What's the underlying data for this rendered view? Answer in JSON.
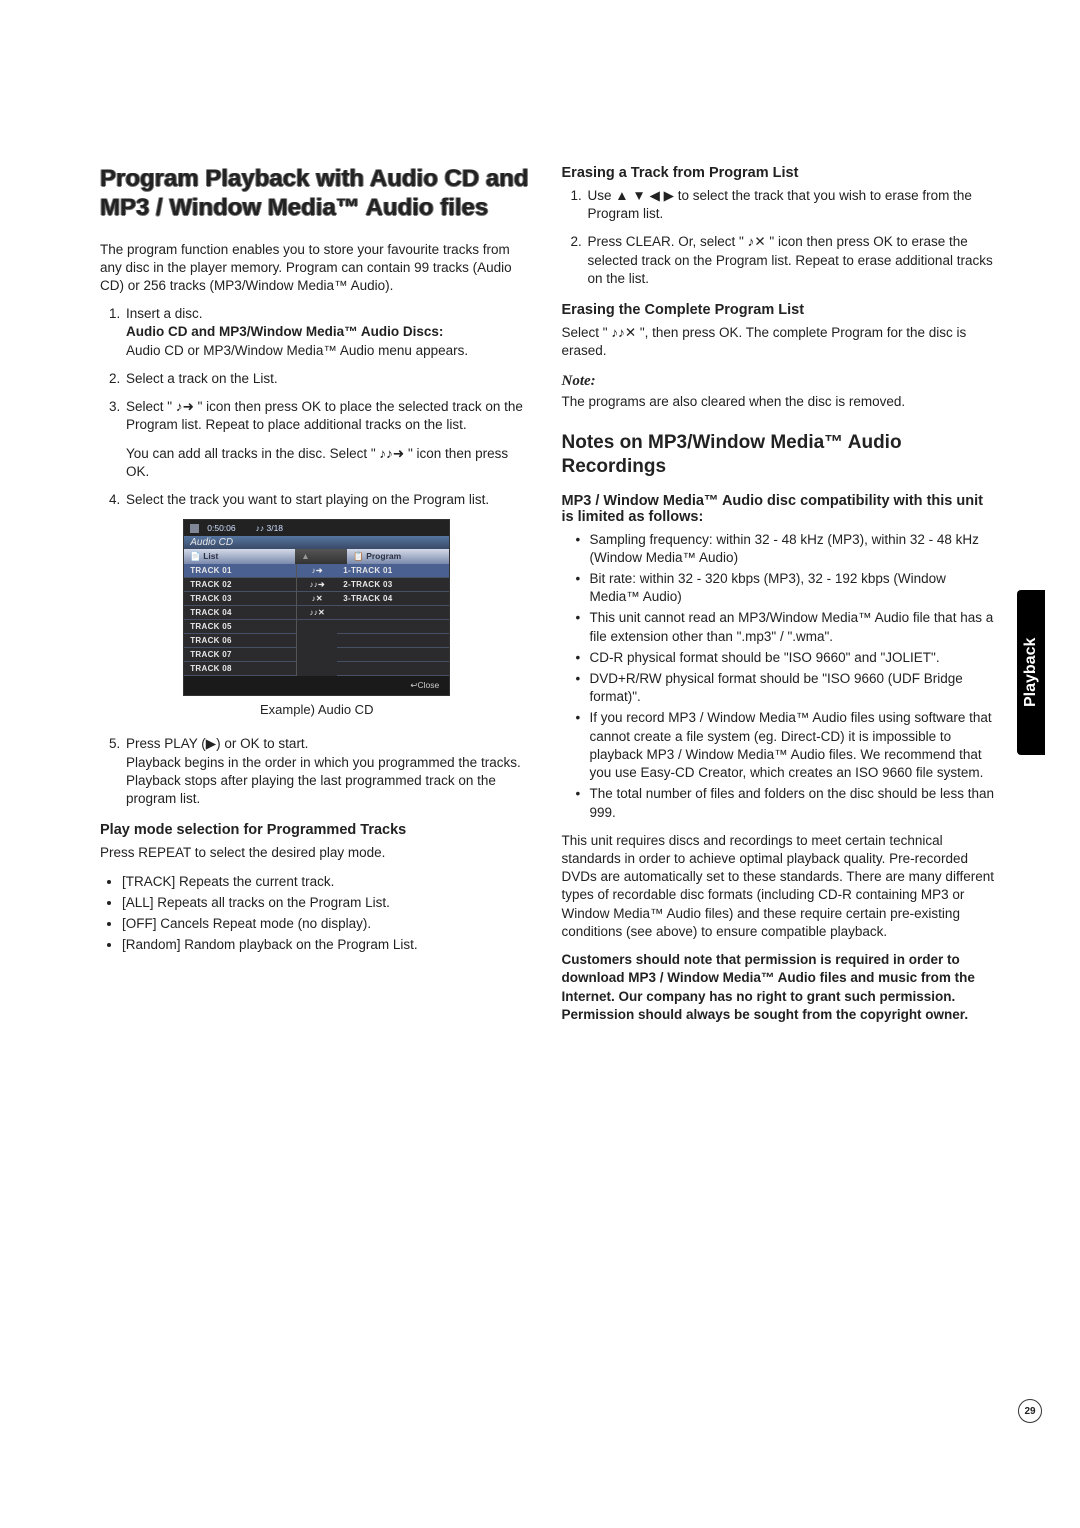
{
  "sidebar_tab": "Playback",
  "page_number": "29",
  "left": {
    "h1": "Program Playback with Audio CD and MP3 / Window Media™ Audio files",
    "intro": "The program function enables you to store your favourite tracks from any disc in the player memory. Program can contain 99 tracks (Audio CD) or 256 tracks (MP3/Window Media™ Audio).",
    "step1a": "Insert a disc.",
    "step1b": "Audio CD and MP3/Window Media™ Audio Discs:",
    "step1c": "Audio CD or MP3/Window Media™ Audio menu appears.",
    "step2": "Select a track on the List.",
    "step3a": "Select \" ♪➜ \" icon then press OK to place the selected track on the Program list. Repeat to place additional tracks on the list.",
    "step3b": "You can add all tracks in the disc. Select \" ♪♪➜ \" icon then press OK.",
    "step4": "Select the track you want to start playing on the Program list.",
    "shot": {
      "time": "0:50:06",
      "counter": "♪♪ 3/18",
      "subtitle": "Audio CD",
      "list_header": "List",
      "prog_header": "Program",
      "tracks": [
        "TRACK 01",
        "TRACK 02",
        "TRACK 03",
        "TRACK 04",
        "TRACK 05",
        "TRACK 06",
        "TRACK 07",
        "TRACK 08"
      ],
      "mids": [
        "♪➜",
        "♪♪➜",
        "♪✕",
        "♪♪✕"
      ],
      "prog": [
        "1-TRACK 01",
        "2-TRACK 03",
        "3-TRACK 04"
      ],
      "close": "↩Close"
    },
    "caption": "Example) Audio CD",
    "step5a": "Press PLAY (▶) or OK to start.",
    "step5b": "Playback begins in the order in which you programmed the tracks.",
    "step5c": "Playback stops after playing the last programmed track on the program list.",
    "h3_playmode": "Play mode selection for Programmed Tracks",
    "playmode_intro": "Press REPEAT to select the desired play mode.",
    "playmodes": [
      "[TRACK] Repeats the current track.",
      "[ALL] Repeats all tracks on the Program List.",
      "[OFF] Cancels Repeat mode (no display).",
      "[Random] Random playback on the Program List."
    ]
  },
  "right": {
    "h3_erase_track": "Erasing a Track from Program List",
    "erase_step1": "Use ▲ ▼ ◀ ▶ to select the track that you wish to erase from the Program list.",
    "erase_step2": "Press CLEAR. Or, select \" ♪✕ \" icon then press OK to erase the selected track on the Program list. Repeat to erase additional tracks on the list.",
    "h3_erase_all": "Erasing the Complete Program List",
    "erase_all_p": "Select \" ♪♪✕ \", then press OK. The complete Program for the disc is erased.",
    "note_label": "Note:",
    "note_p": "The programs are also cleared when the disc is removed.",
    "h2_notes": "Notes on MP3/Window Media™ Audio Recordings",
    "h3_compat": "MP3 / Window Media™ Audio disc compatibility with this unit is limited as follows:",
    "bullets": [
      "Sampling frequency: within 32 - 48 kHz (MP3), within 32 - 48 kHz (Window Media™ Audio)",
      "Bit rate: within 32 - 320 kbps (MP3), 32 - 192 kbps (Window Media™ Audio)",
      "This unit cannot read an MP3/Window Media™ Audio file that has a file extension other than \".mp3\" / \".wma\".",
      "CD-R physical format should be \"ISO 9660\" and \"JOLIET\".",
      "DVD+R/RW physical format should be \"ISO 9660 (UDF Bridge format)\".",
      "If you record MP3 / Window Media™ Audio files using software that cannot create a file system (eg. Direct-CD) it is impossible to playback MP3 / Window Media™ Audio files. We recommend that you use Easy-CD Creator, which creates an ISO 9660 file system.",
      "The total number of files and folders on the disc should be less than 999."
    ],
    "para_req": "This unit requires discs and recordings to meet certain technical standards in order to achieve optimal playback quality. Pre-recorded DVDs are automatically set to these standards. There are many different types of recordable disc formats (including CD-R containing MP3 or Window Media™ Audio files) and these require certain pre-existing conditions (see above) to ensure compatible playback.",
    "para_bold": "Customers should note that permission is required in order to download MP3 / Window Media™ Audio files and music from the Internet. Our company has no right to grant such permission. Permission should always be sought from the copyright owner."
  }
}
